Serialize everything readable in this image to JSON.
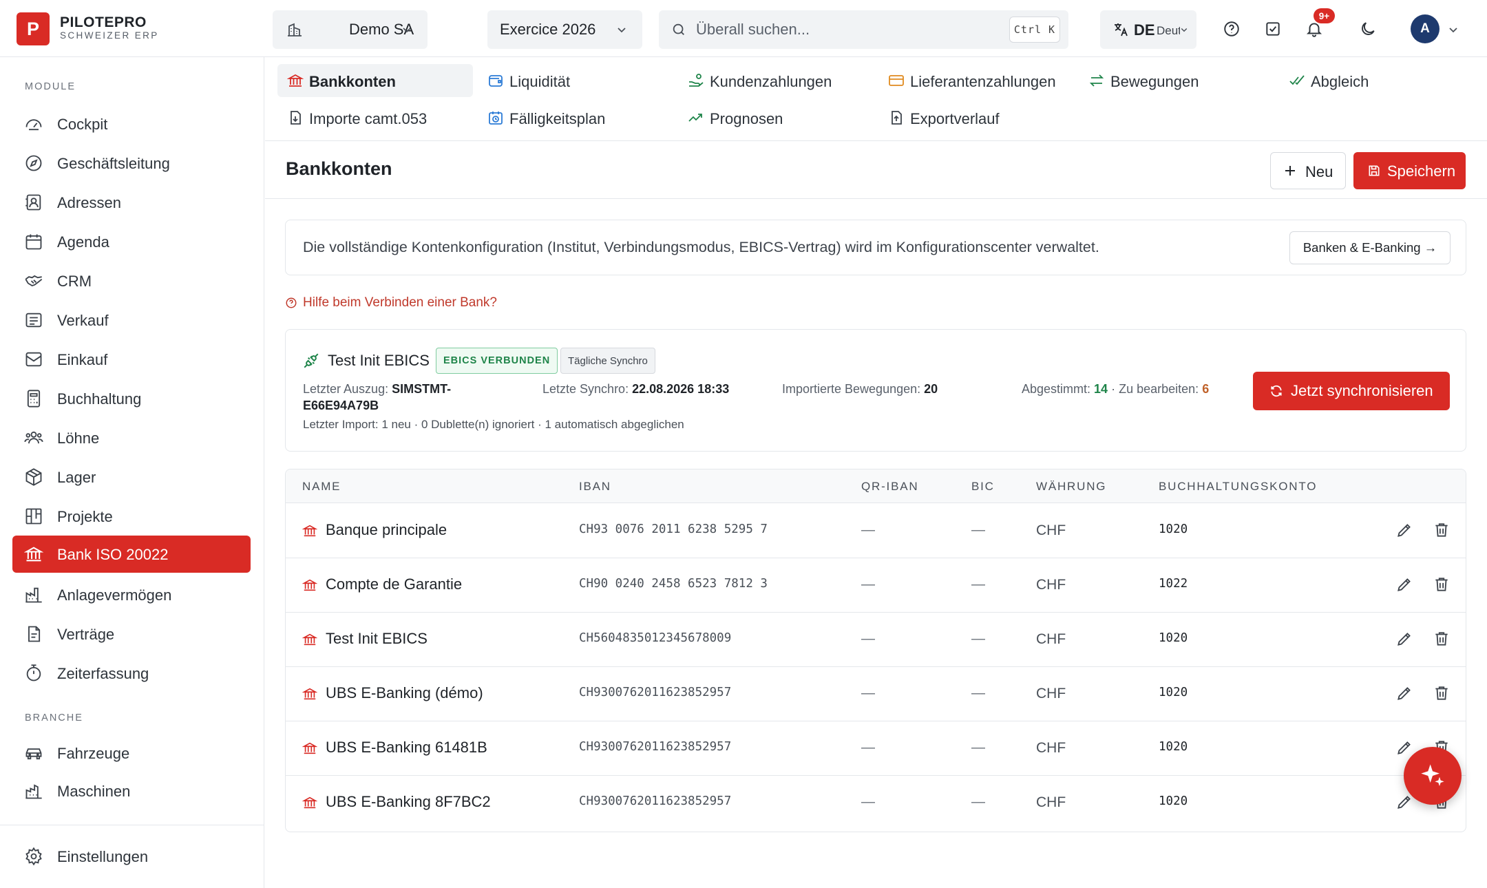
{
  "brand": {
    "logo_letter": "P",
    "name": "PILOTEPRO",
    "subtitle": "SCHWEIZER ERP",
    "color": "#d92b25"
  },
  "topbar": {
    "company": "Demo SA",
    "fiscal_year": "Exercice 2026",
    "search_placeholder": "Überall suchen...",
    "shortcut": "Ctrl K",
    "lang_code": "DE",
    "lang_label": "Deutsch",
    "notifications_badge": "9+",
    "avatar_initial": "A",
    "icons": [
      "building-icon",
      "translate-icon",
      "help-icon",
      "tasks-icon",
      "bell-icon",
      "moon-icon"
    ]
  },
  "sidebar": {
    "section_modules": "MODULE",
    "modules": [
      {
        "label": "Cockpit",
        "icon": "gauge-icon"
      },
      {
        "label": "Geschäftsleitung",
        "icon": "compass-icon"
      },
      {
        "label": "Adressen",
        "icon": "contact-icon"
      },
      {
        "label": "Agenda",
        "icon": "calendar-icon"
      },
      {
        "label": "CRM",
        "icon": "handshake-icon"
      },
      {
        "label": "Verkauf",
        "icon": "receipt-icon"
      },
      {
        "label": "Einkauf",
        "icon": "inbox-icon"
      },
      {
        "label": "Buchhaltung",
        "icon": "calculator-icon"
      },
      {
        "label": "Löhne",
        "icon": "people-icon"
      },
      {
        "label": "Lager",
        "icon": "box-icon"
      },
      {
        "label": "Projekte",
        "icon": "kanban-icon"
      },
      {
        "label": "Bank ISO 20022",
        "icon": "bank-icon",
        "active": true
      },
      {
        "label": "Anlagevermögen",
        "icon": "factory-icon"
      },
      {
        "label": "Verträge",
        "icon": "contract-icon"
      },
      {
        "label": "Zeiterfassung",
        "icon": "timer-icon"
      }
    ],
    "section_industry": "BRANCHE",
    "industry": [
      {
        "label": "Fahrzeuge",
        "icon": "car-icon"
      },
      {
        "label": "Maschinen",
        "icon": "machine-icon"
      }
    ],
    "settings": "Einstellungen"
  },
  "subtabs": [
    {
      "label": "Bankkonten",
      "icon": "bank-icon",
      "active": true
    },
    {
      "label": "Liquidität",
      "icon": "wallet-icon"
    },
    {
      "label": "Kundenzahlungen",
      "icon": "hand-coins-icon"
    },
    {
      "label": "Lieferantenzahlungen",
      "icon": "credit-card-icon"
    },
    {
      "label": "Bewegungen",
      "icon": "arrows-icon"
    },
    {
      "label": "Abgleich",
      "icon": "check-double-icon"
    },
    {
      "label": "Importe camt.053",
      "icon": "file-import-icon"
    },
    {
      "label": "Fälligkeitsplan",
      "icon": "calendar-clock-icon"
    },
    {
      "label": "Prognosen",
      "icon": "trend-icon"
    },
    {
      "label": "Exportverlauf",
      "icon": "file-export-icon"
    }
  ],
  "page": {
    "title": "Bankkonten",
    "new_label": "Neu",
    "save_label": "Speichern"
  },
  "info": {
    "text": "Die vollständige Kontenkonfiguration (Institut, Verbindungsmodus, EBICS-Vertrag) wird im Konfigurationscenter verwaltet.",
    "button": "Banken & E-Banking →"
  },
  "help_link": "Hilfe beim Verbinden einer Bank?",
  "sync": {
    "name": "Test Init EBICS",
    "status_chip": "EBICS VERBUNDEN",
    "schedule_chip": "Tägliche Synchro",
    "last_statement_label": "Letzter Auszug:",
    "last_statement_value_1": "SIMSTMT-",
    "last_statement_value_2": "E66E94A79B",
    "last_sync_label": "Letzte Synchro:",
    "last_sync_value": "22.08.2026 18:33",
    "imported_label": "Importierte Bewegungen:",
    "imported_value": "20",
    "matched_label": "Abgestimmt:",
    "matched_value": "14",
    "sep": "·",
    "todo_label": "Zu bearbeiten:",
    "todo_value": "6",
    "last_import": "Letzter Import: 1 neu · 0 Dublette(n) ignoriert · 1 automatisch abgeglichen",
    "button": "Jetzt synchronisieren"
  },
  "table": {
    "columns": [
      "NAME",
      "IBAN",
      "QR-IBAN",
      "BIC",
      "WÄHRUNG",
      "BUCHHALTUNGSKONTO"
    ],
    "rows": [
      {
        "name": "Banque principale",
        "iban": "CH93 0076 2011 6238 5295 7",
        "qr_iban": "—",
        "bic": "—",
        "currency": "CHF",
        "account": "1020"
      },
      {
        "name": "Compte de Garantie",
        "iban": "CH90 0240 2458 6523 7812 3",
        "qr_iban": "—",
        "bic": "—",
        "currency": "CHF",
        "account": "1022"
      },
      {
        "name": "Test Init EBICS",
        "iban": "CH5604835012345678009",
        "qr_iban": "—",
        "bic": "—",
        "currency": "CHF",
        "account": "1020"
      },
      {
        "name": "UBS E-Banking (démo)",
        "iban": "CH9300762011623852957",
        "qr_iban": "—",
        "bic": "—",
        "currency": "CHF",
        "account": "1020"
      },
      {
        "name": "UBS E-Banking 61481B",
        "iban": "CH9300762011623852957",
        "qr_iban": "—",
        "bic": "—",
        "currency": "CHF",
        "account": "1020"
      },
      {
        "name": "UBS E-Banking 8F7BC2",
        "iban": "CH9300762011623852957",
        "qr_iban": "—",
        "bic": "—",
        "currency": "CHF",
        "account": "1020"
      }
    ]
  },
  "fab": {
    "icon": "sparkle-icon"
  }
}
